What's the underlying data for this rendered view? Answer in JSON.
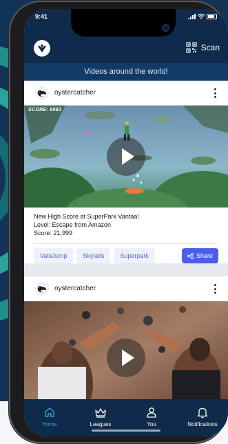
{
  "status_bar": {
    "time": "9:41"
  },
  "app_bar": {
    "scan_label": "Scan"
  },
  "banner": {
    "text": "Videos around the world!"
  },
  "posts": [
    {
      "username": "oystercatcher",
      "video_overlay": "SCORE: 8083",
      "description_lines": [
        "New High Score at SuperPark Vantaa!",
        "Level: Escape from Amazon",
        "Score: 21,999"
      ],
      "tags": [
        "ValoJump",
        "Skytails",
        "Superpark"
      ],
      "share_label": "Share"
    },
    {
      "username": "oystercatcher"
    }
  ],
  "bottom_nav": {
    "items": [
      {
        "label": "Home",
        "icon": "home-icon",
        "active": true
      },
      {
        "label": "Leagues",
        "icon": "crown-icon",
        "active": false
      },
      {
        "label": "You",
        "icon": "user-icon",
        "active": false
      },
      {
        "label": "Notifications",
        "icon": "bell-icon",
        "active": false
      }
    ]
  },
  "colors": {
    "navy": "#0f2a4a",
    "banner": "#123a66",
    "accent_blue": "#4c5fe8",
    "active_nav": "#3aa5d8",
    "tag_text": "#5b67c9",
    "tag_bg": "#eef0fb"
  }
}
